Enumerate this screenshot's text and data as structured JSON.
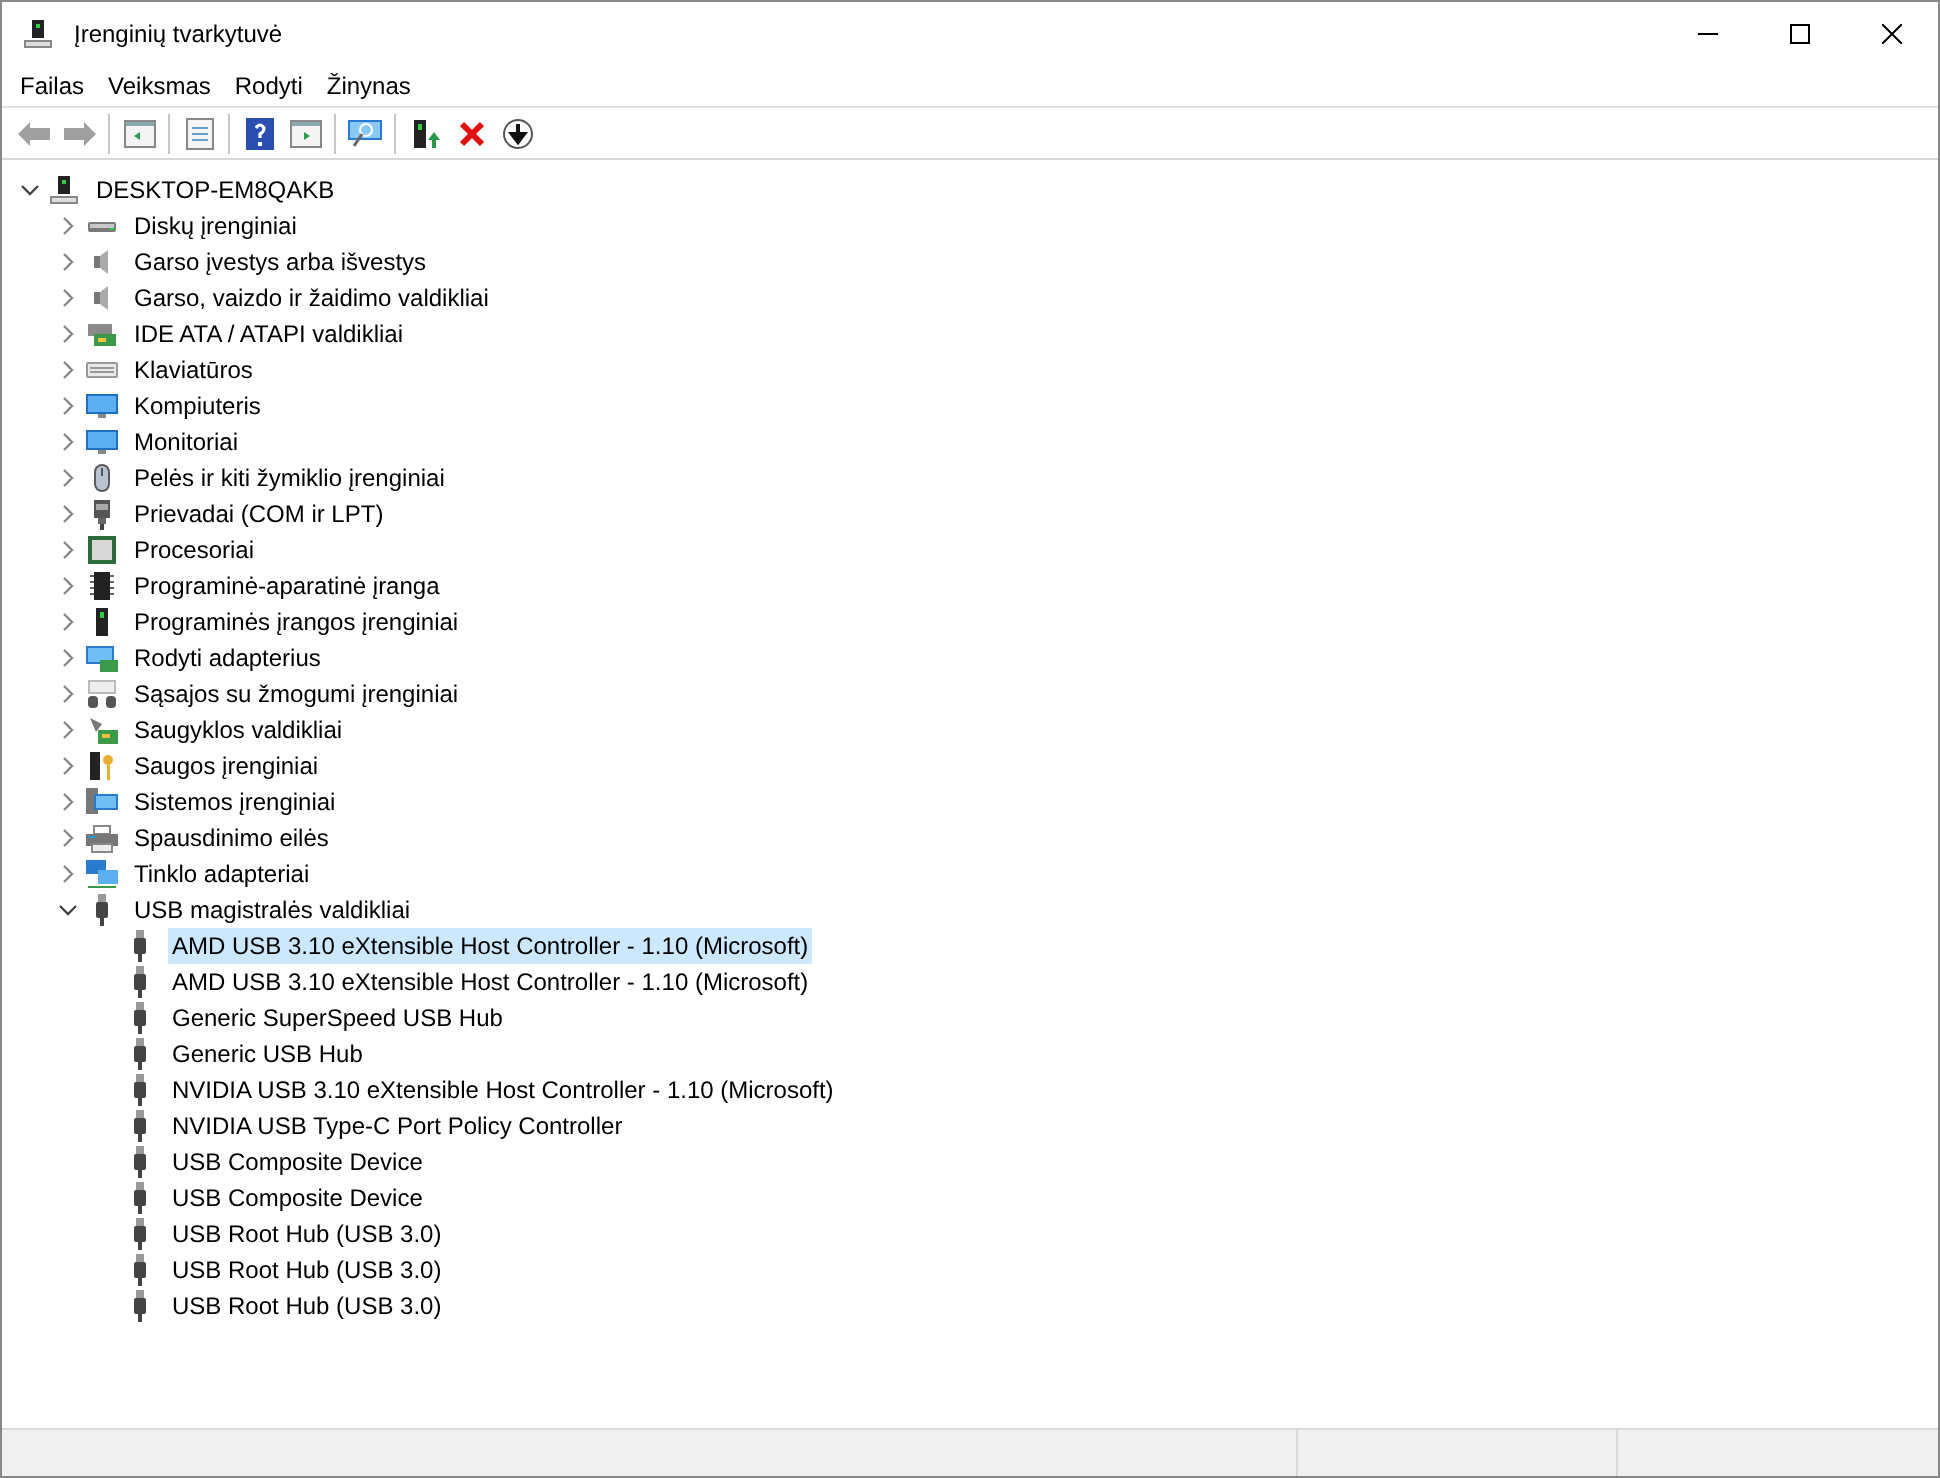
{
  "window": {
    "title": "Įrenginių tvarkytuvė"
  },
  "menu": [
    "Failas",
    "Veiksmas",
    "Rodyti",
    "Žinynas"
  ],
  "tree": {
    "label": "DESKTOP-EM8QAKB",
    "expanded": true,
    "children": [
      {
        "label": "Diskų įrenginiai",
        "expanded": false
      },
      {
        "label": "Garso įvestys arba išvestys",
        "expanded": false
      },
      {
        "label": "Garso, vaizdo ir žaidimo valdikliai",
        "expanded": false
      },
      {
        "label": "IDE ATA / ATAPI valdikliai",
        "expanded": false
      },
      {
        "label": "Klaviatūros",
        "expanded": false
      },
      {
        "label": "Kompiuteris",
        "expanded": false
      },
      {
        "label": "Monitoriai",
        "expanded": false
      },
      {
        "label": "Pelės ir kiti žymiklio įrenginiai",
        "expanded": false
      },
      {
        "label": "Prievadai (COM ir LPT)",
        "expanded": false
      },
      {
        "label": "Procesoriai",
        "expanded": false
      },
      {
        "label": "Programinė-aparatinė įranga",
        "expanded": false
      },
      {
        "label": "Programinės įrangos įrenginiai",
        "expanded": false
      },
      {
        "label": "Rodyti adapterius",
        "expanded": false
      },
      {
        "label": "Sąsajos su žmogumi įrenginiai",
        "expanded": false
      },
      {
        "label": "Saugyklos valdikliai",
        "expanded": false
      },
      {
        "label": "Saugos įrenginiai",
        "expanded": false
      },
      {
        "label": "Sistemos įrenginiai",
        "expanded": false
      },
      {
        "label": "Spausdinimo eilės",
        "expanded": false
      },
      {
        "label": "Tinklo adapteriai",
        "expanded": false
      },
      {
        "label": "USB magistralės valdikliai",
        "expanded": true,
        "children": [
          {
            "label": "AMD USB 3.10 eXtensible Host Controller - 1.10 (Microsoft)",
            "selected": true
          },
          {
            "label": "AMD USB 3.10 eXtensible Host Controller - 1.10 (Microsoft)",
            "selected": false
          },
          {
            "label": "Generic SuperSpeed USB Hub",
            "selected": false
          },
          {
            "label": "Generic USB Hub",
            "selected": false
          },
          {
            "label": "NVIDIA USB 3.10 eXtensible Host Controller - 1.10 (Microsoft)",
            "selected": false
          },
          {
            "label": "NVIDIA USB Type-C Port Policy Controller",
            "selected": false
          },
          {
            "label": "USB Composite Device",
            "selected": false
          },
          {
            "label": "USB Composite Device",
            "selected": false
          },
          {
            "label": "USB Root Hub (USB 3.0)",
            "selected": false
          },
          {
            "label": "USB Root Hub (USB 3.0)",
            "selected": false
          },
          {
            "label": "USB Root Hub (USB 3.0)",
            "selected": false
          }
        ]
      }
    ]
  }
}
